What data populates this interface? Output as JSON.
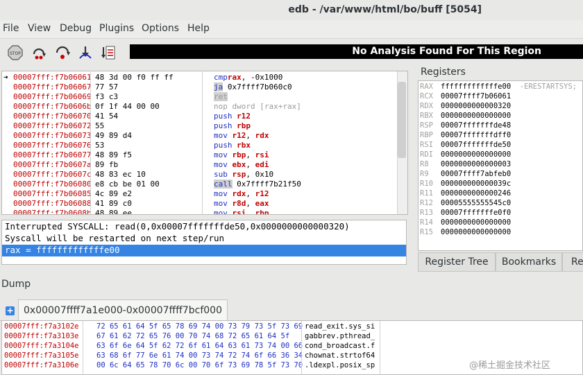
{
  "window": {
    "title": "edb - /var/www/html/bo/buff [5054]"
  },
  "menu": [
    "File",
    "View",
    "Debug",
    "Plugins",
    "Options",
    "Help"
  ],
  "toolbar": {
    "status": "No Analysis Found For This Region",
    "icons": [
      "stop-icon",
      "run-icon",
      "step-into-icon",
      "step-over-icon",
      "list-icon"
    ]
  },
  "disasm": {
    "rows": [
      {
        "addr": "00007fff:f7b06061",
        "bytes": "48 3d 00 f0 ff ff",
        "mn": "cmp",
        "ops": [
          {
            "t": "rax",
            "c": "reg"
          },
          {
            "t": ", -0x1000",
            "c": "imm"
          }
        ],
        "current": true
      },
      {
        "addr": "00007fff:f7b06067",
        "bytes": "77 57",
        "mn": "ja",
        "ops": [
          {
            "t": " 0x7ffff7b060c0",
            "c": "imm"
          }
        ],
        "hlmn": true
      },
      {
        "addr": "00007fff:f7b06069",
        "bytes": "f3 c3",
        "mn": "ret",
        "ops": [],
        "hlmn": true,
        "gray": true
      },
      {
        "addr": "00007fff:f7b0606b",
        "bytes": "0f 1f 44 00 00",
        "mn": "nop dword [rax+rax]",
        "ops": [],
        "gray": true
      },
      {
        "addr": "00007fff:f7b06070",
        "bytes": "41 54",
        "mn": "push",
        "ops": [
          {
            "t": " r12",
            "c": "reg"
          }
        ]
      },
      {
        "addr": "00007fff:f7b06072",
        "bytes": "55",
        "mn": "push",
        "ops": [
          {
            "t": " rbp",
            "c": "reg"
          }
        ]
      },
      {
        "addr": "00007fff:f7b06073",
        "bytes": "49 89 d4",
        "mn": "mov",
        "ops": [
          {
            "t": " r12",
            "c": "reg"
          },
          {
            "t": ", ",
            "c": "imm"
          },
          {
            "t": "rdx",
            "c": "reg"
          }
        ]
      },
      {
        "addr": "00007fff:f7b06076",
        "bytes": "53",
        "mn": "push",
        "ops": [
          {
            "t": " rbx",
            "c": "reg"
          }
        ]
      },
      {
        "addr": "00007fff:f7b06077",
        "bytes": "48 89 f5",
        "mn": "mov",
        "ops": [
          {
            "t": " rbp",
            "c": "reg"
          },
          {
            "t": ", ",
            "c": "imm"
          },
          {
            "t": "rsi",
            "c": "reg"
          }
        ]
      },
      {
        "addr": "00007fff:f7b0607a",
        "bytes": "89 fb",
        "mn": "mov",
        "ops": [
          {
            "t": " ebx",
            "c": "reg"
          },
          {
            "t": ", ",
            "c": "imm"
          },
          {
            "t": "edi",
            "c": "reg"
          }
        ]
      },
      {
        "addr": "00007fff:f7b0607c",
        "bytes": "48 83 ec 10",
        "mn": "sub",
        "ops": [
          {
            "t": " rsp",
            "c": "reg"
          },
          {
            "t": ", 0x10",
            "c": "imm"
          }
        ]
      },
      {
        "addr": "00007fff:f7b06080",
        "bytes": "e8 cb be 01 00",
        "mn": "call",
        "ops": [
          {
            "t": " 0x7ffff7b21f50",
            "c": "imm"
          }
        ],
        "hlmn": true
      },
      {
        "addr": "00007fff:f7b06085",
        "bytes": "4c 89 e2",
        "mn": "mov",
        "ops": [
          {
            "t": " rdx",
            "c": "reg"
          },
          {
            "t": ", ",
            "c": "imm"
          },
          {
            "t": "r12",
            "c": "reg"
          }
        ]
      },
      {
        "addr": "00007fff:f7b06088",
        "bytes": "41 89 c0",
        "mn": "mov",
        "ops": [
          {
            "t": " r8d",
            "c": "reg"
          },
          {
            "t": ", ",
            "c": "imm"
          },
          {
            "t": "eax",
            "c": "reg"
          }
        ]
      },
      {
        "addr": "00007fff:f7b0608b",
        "bytes": "48 89 ee",
        "mn": "mov",
        "ops": [
          {
            "t": " rsi",
            "c": "reg"
          },
          {
            "t": ", ",
            "c": "imm"
          },
          {
            "t": "rbp",
            "c": "reg"
          }
        ]
      }
    ]
  },
  "messages": {
    "line1": "Interrupted SYSCALL: read(0,0x00007fffffffde50,0x0000000000000320)",
    "line2": "Syscall will be restarted on next step/run",
    "line3": "rax = fffffffffffffe00"
  },
  "registers": {
    "title": "Registers",
    "rows": [
      {
        "name": "RAX",
        "value": "fffffffffffffe00",
        "comment": "-ERESTARTSYS;"
      },
      {
        "name": "RCX",
        "value": "00007ffff7b06061",
        "comment": ""
      },
      {
        "name": "RDX",
        "value": "0000000000000320",
        "comment": ""
      },
      {
        "name": "RBX",
        "value": "0000000000000000",
        "comment": ""
      },
      {
        "name": "RSP",
        "value": "00007fffffffde48",
        "comment": ""
      },
      {
        "name": "RBP",
        "value": "00007fffffffdff0",
        "comment": ""
      },
      {
        "name": "RSI",
        "value": "00007fffffffde50",
        "comment": ""
      },
      {
        "name": "RDI",
        "value": "0000000000000000",
        "comment": ""
      },
      {
        "name": "R8",
        "value": "0000000000000003",
        "comment": ""
      },
      {
        "name": "R9",
        "value": "00007ffff7abfeb0",
        "comment": ""
      },
      {
        "name": "R10",
        "value": "000000000000039c",
        "comment": ""
      },
      {
        "name": "R11",
        "value": "0000000000000246",
        "comment": ""
      },
      {
        "name": "R12",
        "value": "00005555555545c0",
        "comment": ""
      },
      {
        "name": "R13",
        "value": "00007fffffffe0f0",
        "comment": ""
      },
      {
        "name": "R14",
        "value": "0000000000000000",
        "comment": ""
      },
      {
        "name": "R15",
        "value": "0000000000000000",
        "comment": ""
      }
    ],
    "tabs": [
      "Register Tree",
      "Bookmarks",
      "Re"
    ]
  },
  "dump": {
    "title": "Dump",
    "tab": "0x00007ffff7a1e000-0x00007ffff7bcf000",
    "rows": [
      {
        "addr": "00007fff:f7a3102e",
        "hex": "72 65 61 64 5f 65 78 69 74 00 73 79 73 5f 73 69",
        "ascii": "read_exit.sys_si"
      },
      {
        "addr": "00007fff:f7a3103e",
        "hex": "67 61 62 72 65 76 00 70 74 68 72 65 61 64 5f",
        "ascii": "gabbrev.pthread_"
      },
      {
        "addr": "00007fff:f7a3104e",
        "hex": "63 6f 6e 64 5f 62 72 6f 61 64 63 61 73 74 00 66",
        "ascii": "cond_broadcast.f"
      },
      {
        "addr": "00007fff:f7a3105e",
        "hex": "63 68 6f 77 6e 61 74 00 73 74 72 74 6f 66 36 34",
        "ascii": "chownat.strtof64"
      },
      {
        "addr": "00007fff:f7a3106e",
        "hex": "00 6c 64 65 78 70 6c 00 70 6f 73 69 78 5f 73 70",
        "ascii": ".ldexpl.posix_sp"
      }
    ]
  },
  "watermark": "@稀土掘金技术社区"
}
